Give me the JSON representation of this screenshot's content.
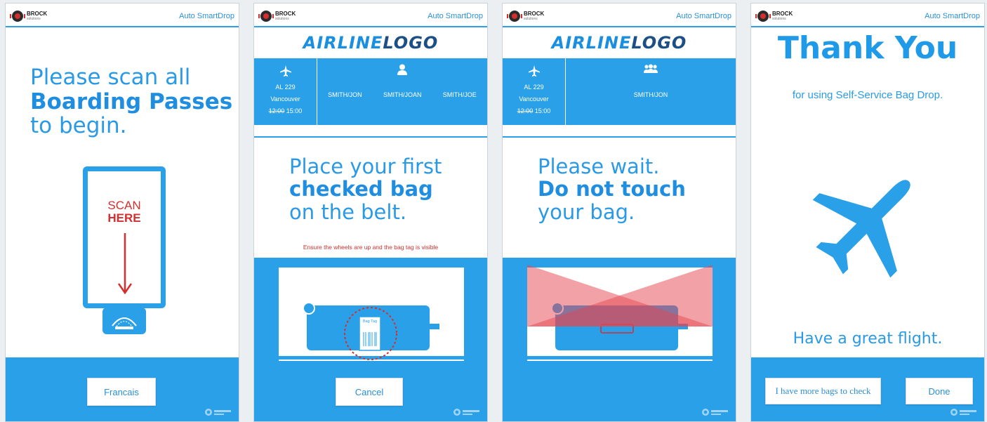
{
  "app_name": "Auto SmartDrop",
  "brand": {
    "name": "BROCK",
    "sub": "solutions"
  },
  "colors": {
    "primary": "#2aa0e8",
    "accent_red": "#d32f2f",
    "logo_dark": "#1c4f86"
  },
  "screen1": {
    "line1": "Please scan all",
    "line2": "Boarding Passes",
    "line3": "to begin.",
    "scanner_line1": "SCAN",
    "scanner_line2": "HERE",
    "button": "Francais"
  },
  "airline_logo": {
    "part1": "AIRLINE",
    "part2": "LOGO"
  },
  "flight": {
    "number": "AL 229",
    "city": "Vancouver",
    "old_time": "12:00",
    "new_time": "15:00"
  },
  "screen2": {
    "passengers": [
      "SMITH/JON",
      "SMITH/JOAN",
      "SMITH/JOE"
    ],
    "line1": "Place your first",
    "line2": "checked bag",
    "line3": "on the belt.",
    "warning": "Ensure the wheels are up and the bag tag is visible",
    "bag_tag_label": "Bag Tag",
    "button": "Cancel"
  },
  "screen3": {
    "passengers": [
      "SMITH/JON"
    ],
    "line1": "Please wait.",
    "line2": "Do not touch",
    "line3": "your bag."
  },
  "screen4": {
    "title": "Thank You",
    "subtitle": "for using Self-Service Bag Drop.",
    "closing": "Have a great flight.",
    "button_more": "I have more bags to check",
    "button_done": "Done"
  }
}
